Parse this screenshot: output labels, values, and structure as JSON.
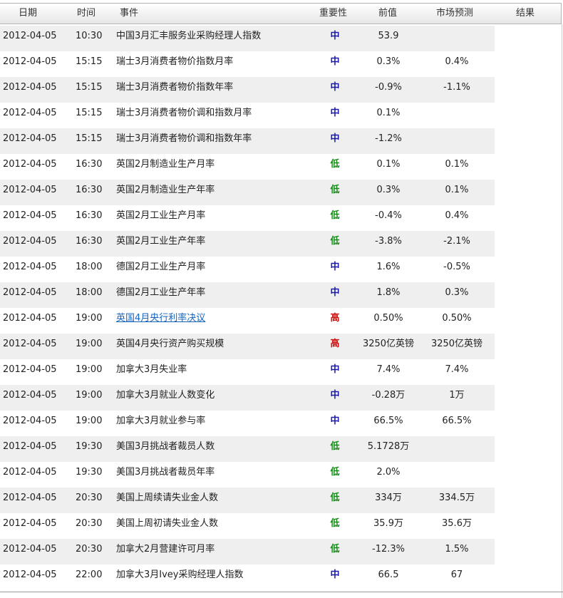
{
  "header": {
    "date": "日期",
    "time": "时间",
    "event": "事件",
    "importance": "重要性",
    "previous": "前值",
    "forecast": "市场预测",
    "result": "结果"
  },
  "colors": {
    "mid": "#1a1aa6",
    "low": "#168a16",
    "high": "#cc1111",
    "link": "#1565c0"
  },
  "rows": [
    {
      "date": "2012-04-05",
      "time": "10:30",
      "event": "中国3月汇丰服务业采购经理人指数",
      "importance": "中",
      "level": "mid",
      "previous": "53.9",
      "forecast": "",
      "result": "",
      "link": false
    },
    {
      "date": "2012-04-05",
      "time": "15:15",
      "event": "瑞士3月消费者物价指数月率",
      "importance": "中",
      "level": "mid",
      "previous": "0.3%",
      "forecast": "0.4%",
      "result": "",
      "link": false
    },
    {
      "date": "2012-04-05",
      "time": "15:15",
      "event": "瑞士3月消费者物价指数年率",
      "importance": "中",
      "level": "mid",
      "previous": "-0.9%",
      "forecast": "-1.1%",
      "result": "",
      "link": false
    },
    {
      "date": "2012-04-05",
      "time": "15:15",
      "event": "瑞士3月消费者物价调和指数月率",
      "importance": "中",
      "level": "mid",
      "previous": "0.1%",
      "forecast": "",
      "result": "",
      "link": false
    },
    {
      "date": "2012-04-05",
      "time": "15:15",
      "event": "瑞士3月消费者物价调和指数年率",
      "importance": "中",
      "level": "mid",
      "previous": "-1.2%",
      "forecast": "",
      "result": "",
      "link": false
    },
    {
      "date": "2012-04-05",
      "time": "16:30",
      "event": "英国2月制造业生产月率",
      "importance": "低",
      "level": "low",
      "previous": "0.1%",
      "forecast": "0.1%",
      "result": "",
      "link": false
    },
    {
      "date": "2012-04-05",
      "time": "16:30",
      "event": "英国2月制造业生产年率",
      "importance": "低",
      "level": "low",
      "previous": "0.3%",
      "forecast": "0.1%",
      "result": "",
      "link": false
    },
    {
      "date": "2012-04-05",
      "time": "16:30",
      "event": "英国2月工业生产月率",
      "importance": "低",
      "level": "low",
      "previous": "-0.4%",
      "forecast": "0.4%",
      "result": "",
      "link": false
    },
    {
      "date": "2012-04-05",
      "time": "16:30",
      "event": "英国2月工业生产年率",
      "importance": "低",
      "level": "low",
      "previous": "-3.8%",
      "forecast": "-2.1%",
      "result": "",
      "link": false
    },
    {
      "date": "2012-04-05",
      "time": "18:00",
      "event": "德国2月工业生产月率",
      "importance": "中",
      "level": "mid",
      "previous": "1.6%",
      "forecast": "-0.5%",
      "result": "",
      "link": false
    },
    {
      "date": "2012-04-05",
      "time": "18:00",
      "event": "德国2月工业生产年率",
      "importance": "中",
      "level": "mid",
      "previous": "1.8%",
      "forecast": "0.3%",
      "result": "",
      "link": false
    },
    {
      "date": "2012-04-05",
      "time": "19:00",
      "event": "英国4月央行利率决议",
      "importance": "高",
      "level": "high",
      "previous": "0.50%",
      "forecast": "0.50%",
      "result": "",
      "link": true
    },
    {
      "date": "2012-04-05",
      "time": "19:00",
      "event": "英国4月央行资产购买规模",
      "importance": "高",
      "level": "high",
      "previous": "3250亿英镑",
      "forecast": "3250亿英镑",
      "result": "",
      "link": false
    },
    {
      "date": "2012-04-05",
      "time": "19:00",
      "event": "加拿大3月失业率",
      "importance": "中",
      "level": "mid",
      "previous": "7.4%",
      "forecast": "7.4%",
      "result": "",
      "link": false
    },
    {
      "date": "2012-04-05",
      "time": "19:00",
      "event": "加拿大3月就业人数变化",
      "importance": "中",
      "level": "mid",
      "previous": "-0.28万",
      "forecast": "1万",
      "result": "",
      "link": false
    },
    {
      "date": "2012-04-05",
      "time": "19:00",
      "event": "加拿大3月就业参与率",
      "importance": "中",
      "level": "mid",
      "previous": "66.5%",
      "forecast": "66.5%",
      "result": "",
      "link": false
    },
    {
      "date": "2012-04-05",
      "time": "19:30",
      "event": "美国3月挑战者裁员人数",
      "importance": "低",
      "level": "low",
      "previous": "5.1728万",
      "forecast": "",
      "result": "",
      "link": false
    },
    {
      "date": "2012-04-05",
      "time": "19:30",
      "event": "美国3月挑战者裁员年率",
      "importance": "低",
      "level": "low",
      "previous": "2.0%",
      "forecast": "",
      "result": "",
      "link": false
    },
    {
      "date": "2012-04-05",
      "time": "20:30",
      "event": "美国上周续请失业金人数",
      "importance": "低",
      "level": "low",
      "previous": "334万",
      "forecast": "334.5万",
      "result": "",
      "link": false
    },
    {
      "date": "2012-04-05",
      "time": "20:30",
      "event": "美国上周初请失业金人数",
      "importance": "低",
      "level": "low",
      "previous": "35.9万",
      "forecast": "35.6万",
      "result": "",
      "link": false
    },
    {
      "date": "2012-04-05",
      "time": "20:30",
      "event": "加拿大2月营建许可月率",
      "importance": "低",
      "level": "low",
      "previous": "-12.3%",
      "forecast": "1.5%",
      "result": "",
      "link": false
    },
    {
      "date": "2012-04-05",
      "time": "22:00",
      "event": "加拿大3月Ivey采购经理人指数",
      "importance": "中",
      "level": "mid",
      "previous": "66.5",
      "forecast": "67",
      "result": "",
      "link": false
    }
  ]
}
